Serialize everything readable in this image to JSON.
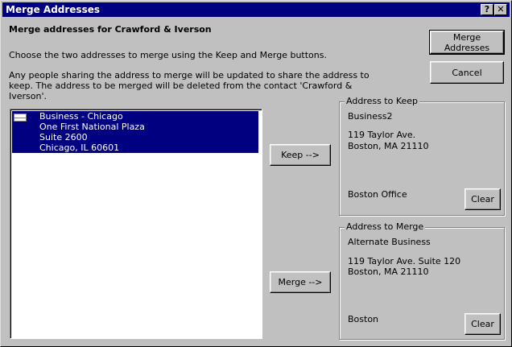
{
  "window": {
    "title": "Merge Addresses",
    "help_button": "?",
    "close_button": "✕"
  },
  "heading": "Merge addresses for Crawford & Iverson",
  "instructions": "Choose the two addresses to merge using the Keep and Merge buttons.",
  "info_lines": [
    "Any people sharing the address to merge will be updated to share the address to",
    "keep. The address to be merged will be deleted from the contact 'Crawford &",
    "Iverson'."
  ],
  "buttons": {
    "merge_addresses": "Merge Addresses",
    "cancel": "Cancel",
    "keep": "Keep -->",
    "merge": "Merge -->",
    "clear_keep": "Clear",
    "clear_merge": "Clear"
  },
  "address_list": [
    {
      "icon": "envelope-icon",
      "lines": [
        "Business - Chicago",
        "One First National Plaza",
        "Suite 2600",
        "Chicago, IL 60601"
      ],
      "selected": true
    }
  ],
  "address_to_keep": {
    "label": "Address to Keep",
    "type": "Business2",
    "street": "119 Taylor Ave.",
    "city": "Boston, MA 21110",
    "note": "Boston Office"
  },
  "address_to_merge": {
    "label": "Address to Merge",
    "type": "Alternate Business",
    "street": "119 Taylor Ave. Suite 120",
    "city": "Boston, MA 21110",
    "note": "Boston"
  }
}
